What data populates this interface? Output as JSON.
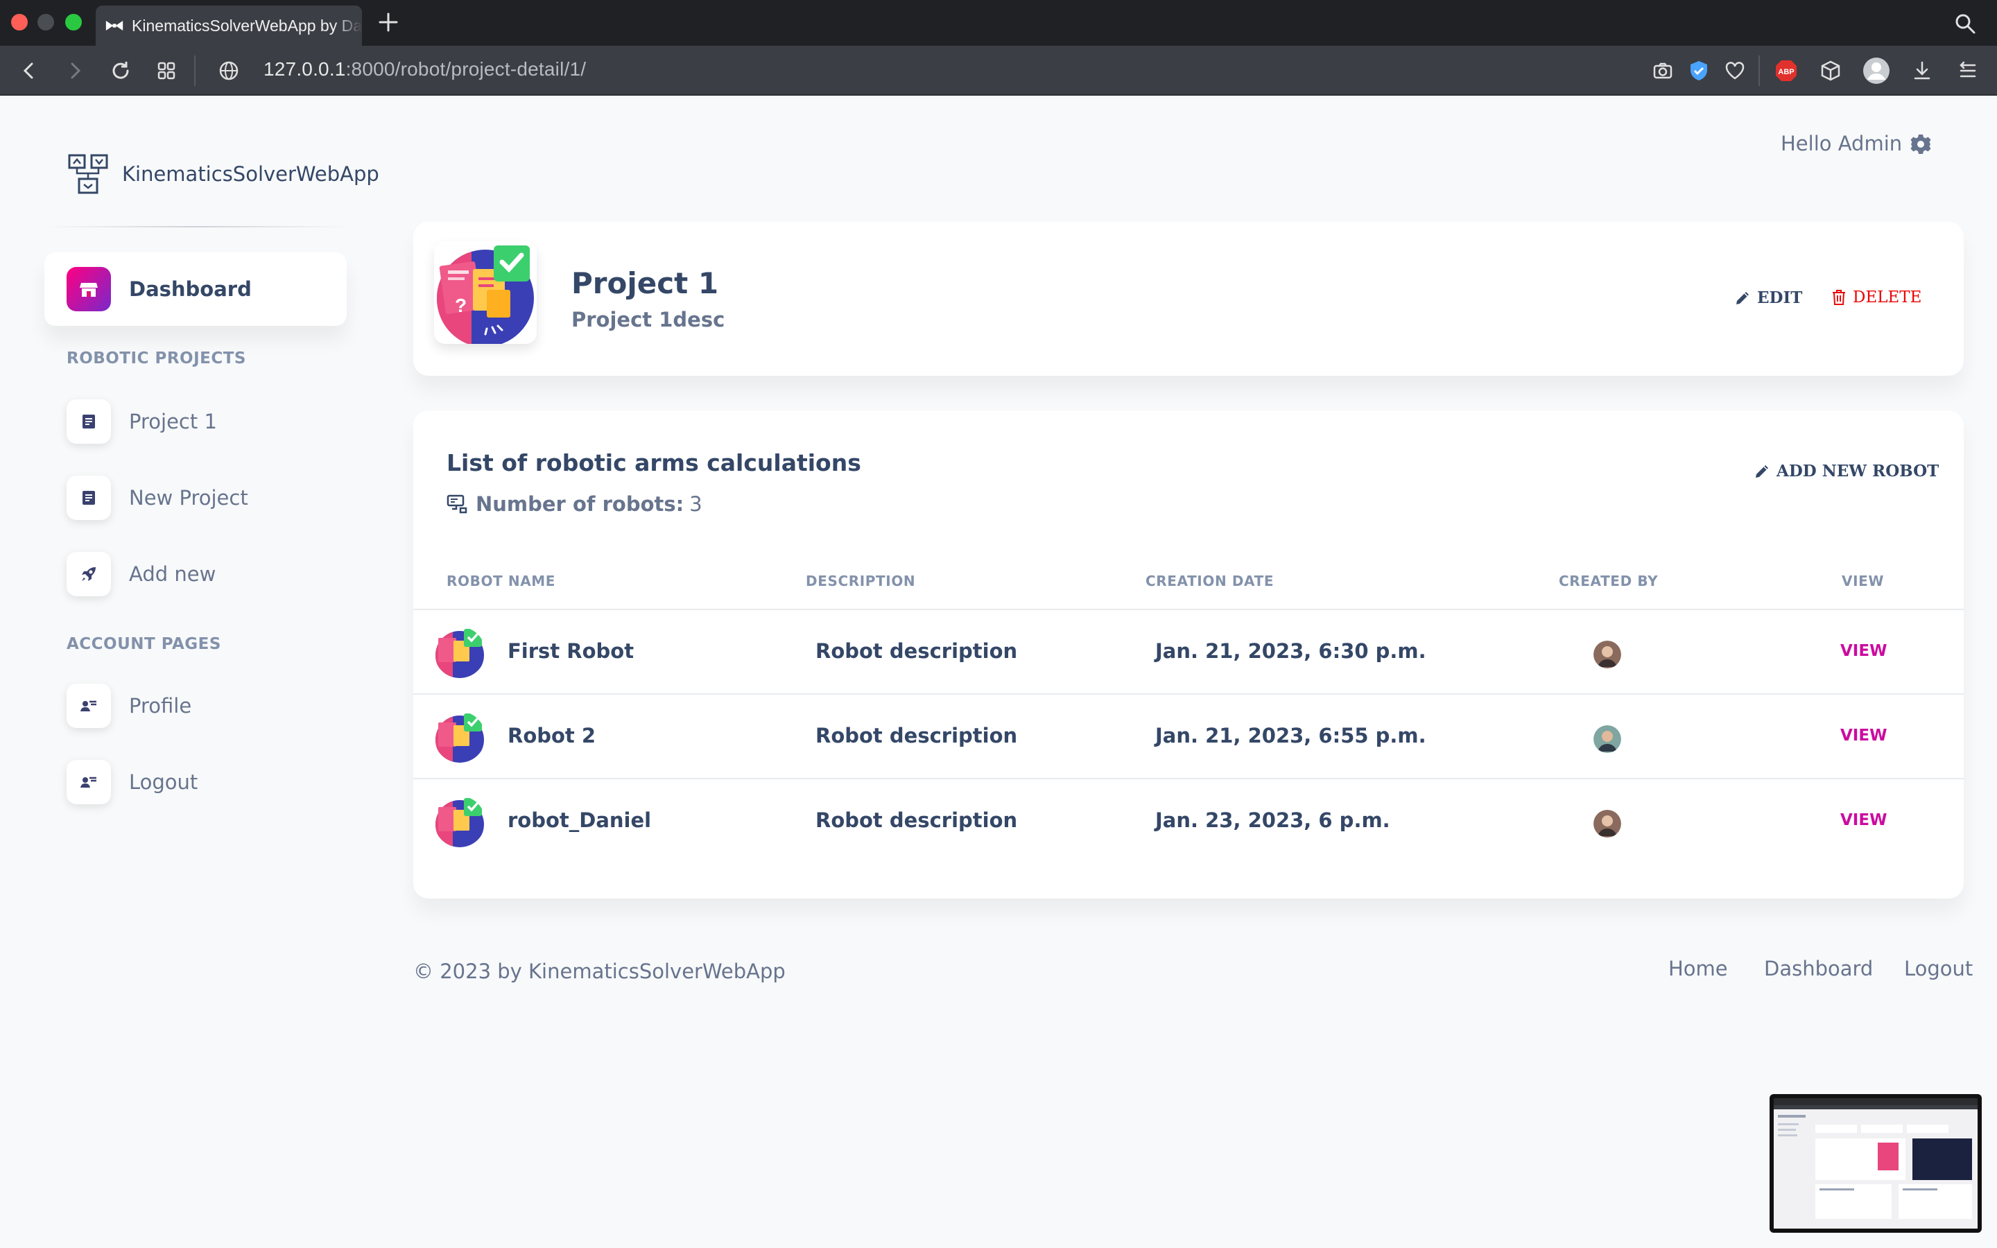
{
  "browser": {
    "tab_title": "KinematicsSolverWebApp by Da",
    "url_host": "127.0.0.1",
    "url_path": ":8000/robot/project-detail/1/"
  },
  "brand": {
    "name": "KinematicsSolverWebApp"
  },
  "header": {
    "greeting": "Hello Admin"
  },
  "sidebar": {
    "dashboard_label": "Dashboard",
    "section_projects": "ROBOTIC PROJECTS",
    "projects": [
      {
        "label": "Project 1",
        "icon": "document-icon"
      },
      {
        "label": "New Project",
        "icon": "document-icon"
      },
      {
        "label": "Add new",
        "icon": "rocket-icon"
      }
    ],
    "section_account": "ACCOUNT PAGES",
    "account": [
      {
        "label": "Profile",
        "icon": "user-card-icon"
      },
      {
        "label": "Logout",
        "icon": "user-card-icon"
      }
    ]
  },
  "project": {
    "name": "Project 1",
    "description": "Project 1desc",
    "edit_label": "EDIT",
    "delete_label": "DELETE"
  },
  "robots": {
    "title": "List of robotic arms calculations",
    "count_label": "Number of robots:",
    "count": "3",
    "add_label": "ADD NEW ROBOT",
    "columns": [
      "ROBOT NAME",
      "DESCRIPTION",
      "CREATION DATE",
      "CREATED BY",
      "VIEW"
    ],
    "rows": [
      {
        "name": "First Robot",
        "description": "Robot description",
        "date": "Jan. 21, 2023, 6:30 p.m.",
        "view": "VIEW"
      },
      {
        "name": "Robot 2",
        "description": "Robot description",
        "date": "Jan. 21, 2023, 6:55 p.m.",
        "view": "VIEW"
      },
      {
        "name": "robot_Daniel",
        "description": "Robot description",
        "date": "Jan. 23, 2023, 6 p.m.",
        "view": "VIEW"
      }
    ]
  },
  "footer": {
    "copyright": "© 2023 by KinematicsSolverWebApp",
    "links": [
      "Home",
      "Dashboard",
      "Logout"
    ]
  },
  "colors": {
    "accent": "#cb0c9f",
    "danger": "#ea0606",
    "text": "#344767",
    "muted": "#67748e"
  }
}
